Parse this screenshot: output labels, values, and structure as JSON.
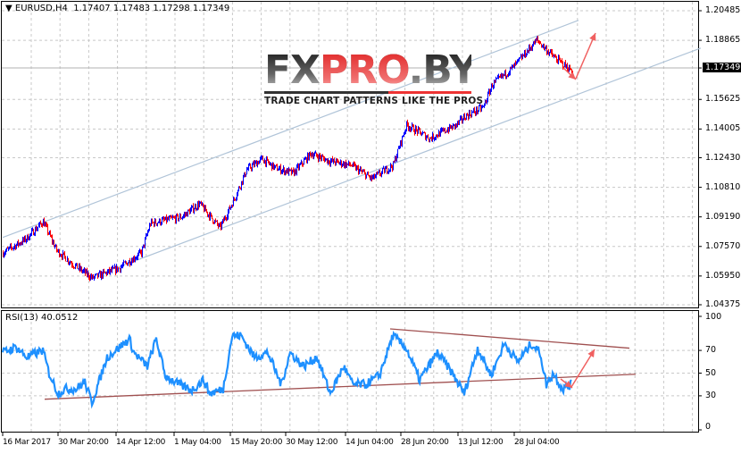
{
  "header": {
    "symbol_label": "EURUSD,H4",
    "open": "1.17407",
    "high": "1.17483",
    "low": "1.17298",
    "close": "1.17349"
  },
  "rsi_header": {
    "label": "RSI(13)",
    "value": "40.0512"
  },
  "logo": {
    "brand_dark": "FX",
    "brand_red": "PRO",
    "brand_dark2": ".BY",
    "tagline": "TRADE CHART PATTERNS LIKE THE PROS"
  },
  "colors": {
    "up_bar": "#0000ff",
    "down_bar": "#ff0000",
    "rsi_line": "#1e90ff",
    "channel": "#b0c4d8",
    "rsi_trend": "#a05050",
    "arrow": "#f06060",
    "grid": "#c8c8c8"
  },
  "chart_data": [
    {
      "type": "line",
      "title": "EURUSD,H4",
      "price_axis": {
        "labels": [
          "1.20485",
          "1.18865",
          "1.17349",
          "1.15625",
          "1.14005",
          "1.12430",
          "1.10810",
          "1.09190",
          "1.07570",
          "1.05950",
          "1.04375"
        ],
        "current": "1.17349",
        "ylim": [
          1.04375,
          1.20485
        ]
      },
      "x_axis": {
        "labels": [
          {
            "text": "16 Mar 2017",
            "bar": 0
          },
          {
            "text": "30 Mar 20:00",
            "bar": 62
          },
          {
            "text": "14 Apr 12:00",
            "bar": 127
          },
          {
            "text": "1 May 04:00",
            "bar": 192
          },
          {
            "text": "15 May 20:00",
            "bar": 255
          },
          {
            "text": "30 May 12:00",
            "bar": 317
          },
          {
            "text": "14 Jun 04:00",
            "bar": 384
          },
          {
            "text": "28 Jun 20:00",
            "bar": 446
          },
          {
            "text": "13 Jul 12:00",
            "bar": 510
          },
          {
            "text": "28 Jul 04:00",
            "bar": 573
          }
        ]
      },
      "close_path": [
        [
          0,
          1.0722
        ],
        [
          25,
          1.0795
        ],
        [
          45,
          1.0893
        ],
        [
          60,
          1.0736
        ],
        [
          80,
          1.0653
        ],
        [
          100,
          1.0584
        ],
        [
          130,
          1.0638
        ],
        [
          155,
          1.0722
        ],
        [
          165,
          1.0883
        ],
        [
          200,
          1.0918
        ],
        [
          220,
          1.0991
        ],
        [
          243,
          1.0859
        ],
        [
          258,
          1.1006
        ],
        [
          273,
          1.1177
        ],
        [
          290,
          1.1236
        ],
        [
          305,
          1.1187
        ],
        [
          325,
          1.1158
        ],
        [
          345,
          1.1266
        ],
        [
          365,
          1.1226
        ],
        [
          390,
          1.1202
        ],
        [
          413,
          1.1128
        ],
        [
          437,
          1.1202
        ],
        [
          452,
          1.1423
        ],
        [
          478,
          1.1349
        ],
        [
          508,
          1.1423
        ],
        [
          518,
          1.1471
        ],
        [
          538,
          1.152
        ],
        [
          548,
          1.1643
        ],
        [
          572,
          1.1741
        ],
        [
          598,
          1.1888
        ],
        [
          618,
          1.179
        ],
        [
          638,
          1.1716
        ]
      ],
      "channel_upper": [
        [
          0,
          1.0806
        ],
        [
          645,
          1.1996
        ]
      ],
      "channel_lower": [
        [
          97,
          1.0584
        ],
        [
          782,
          1.1844
        ]
      ]
    },
    {
      "type": "line",
      "title": "RSI(13) 40.0512",
      "y_axis": {
        "labels": [
          "100",
          "70",
          "50",
          "30",
          "0"
        ],
        "ylim": [
          0,
          100
        ]
      },
      "rsi_path": [
        [
          0,
          68
        ],
        [
          15,
          73
        ],
        [
          27,
          64
        ],
        [
          45,
          70
        ],
        [
          52,
          50
        ],
        [
          62,
          32
        ],
        [
          70,
          36
        ],
        [
          82,
          36
        ],
        [
          92,
          42
        ],
        [
          100,
          24
        ],
        [
          117,
          64
        ],
        [
          142,
          80
        ],
        [
          147,
          68
        ],
        [
          162,
          56
        ],
        [
          172,
          80
        ],
        [
          182,
          48
        ],
        [
          197,
          40
        ],
        [
          212,
          35
        ],
        [
          225,
          44
        ],
        [
          232,
          32
        ],
        [
          247,
          36
        ],
        [
          257,
          83
        ],
        [
          267,
          83
        ],
        [
          282,
          64
        ],
        [
          297,
          68
        ],
        [
          312,
          40
        ],
        [
          322,
          68
        ],
        [
          337,
          56
        ],
        [
          352,
          64
        ],
        [
          367,
          32
        ],
        [
          382,
          56
        ],
        [
          392,
          40
        ],
        [
          407,
          40
        ],
        [
          422,
          48
        ],
        [
          437,
          83
        ],
        [
          452,
          72
        ],
        [
          467,
          44
        ],
        [
          487,
          68
        ],
        [
          502,
          52
        ],
        [
          517,
          32
        ],
        [
          532,
          72
        ],
        [
          547,
          48
        ],
        [
          562,
          76
        ],
        [
          577,
          60
        ],
        [
          592,
          76
        ],
        [
          602,
          68
        ],
        [
          609,
          40
        ],
        [
          617,
          50
        ],
        [
          627,
          36
        ],
        [
          637,
          40
        ]
      ],
      "trend_lower": [
        [
          47,
          27
        ],
        [
          709,
          49
        ]
      ],
      "trend_upper": [
        [
          434,
          89
        ],
        [
          702,
          72
        ]
      ]
    }
  ]
}
